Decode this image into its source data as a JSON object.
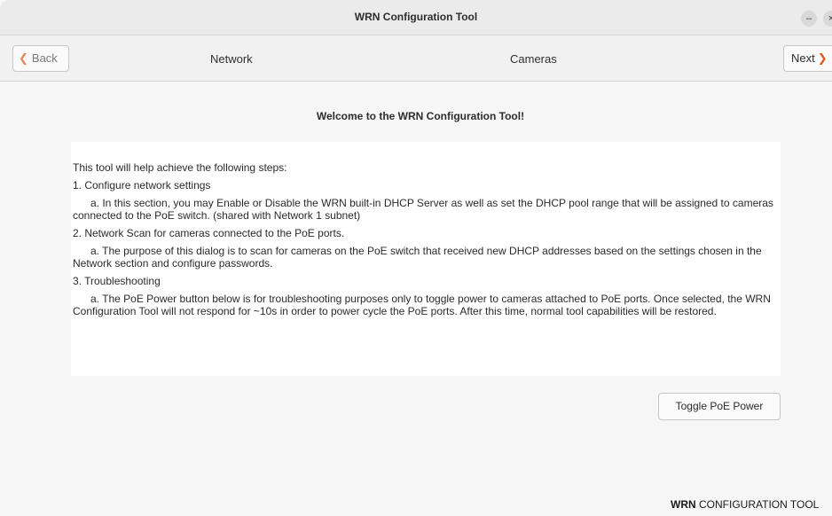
{
  "window": {
    "title": "WRN Configuration Tool",
    "minimize_glyph": "–",
    "close_glyph": "×"
  },
  "nav": {
    "back_label": "Back",
    "next_label": "Next",
    "back_icon": "chevron-left-icon",
    "next_icon": "chevron-right-icon",
    "tabs": [
      "Network",
      "Cameras"
    ]
  },
  "main": {
    "welcome": "Welcome to the WRN Configuration Tool!",
    "intro": "This tool will help achieve the following steps:",
    "steps": [
      {
        "title": "1.  Configure network settings",
        "detail": "a.   In this section, you may Enable or Disable the WRN built-in DHCP Server as well as set the DHCP pool range that will be assigned to cameras connected to the PoE switch. (shared with Network 1 subnet)"
      },
      {
        "title": "2.  Network Scan for cameras connected to the PoE ports.",
        "detail": "a.   The purpose of this dialog is to scan for cameras on the PoE switch that received new DHCP addresses based on the settings chosen in the Network section and configure passwords."
      },
      {
        "title": "3.  Troubleshooting",
        "detail": "a.   The PoE Power button below is for troubleshooting purposes only to toggle power to cameras attached to PoE ports.  Once selected, the WRN Configuration Tool will not respond for ~10s in order to power cycle the PoE ports.  After this time, normal tool capabilities will be restored."
      }
    ],
    "toggle_button": "Toggle PoE Power"
  },
  "footer": {
    "brand_bold": "WRN",
    "brand_rest": " CONFIGURATION TOOL"
  },
  "colors": {
    "accent_next": "#e05a1f",
    "accent_back": "#e08a5c"
  }
}
